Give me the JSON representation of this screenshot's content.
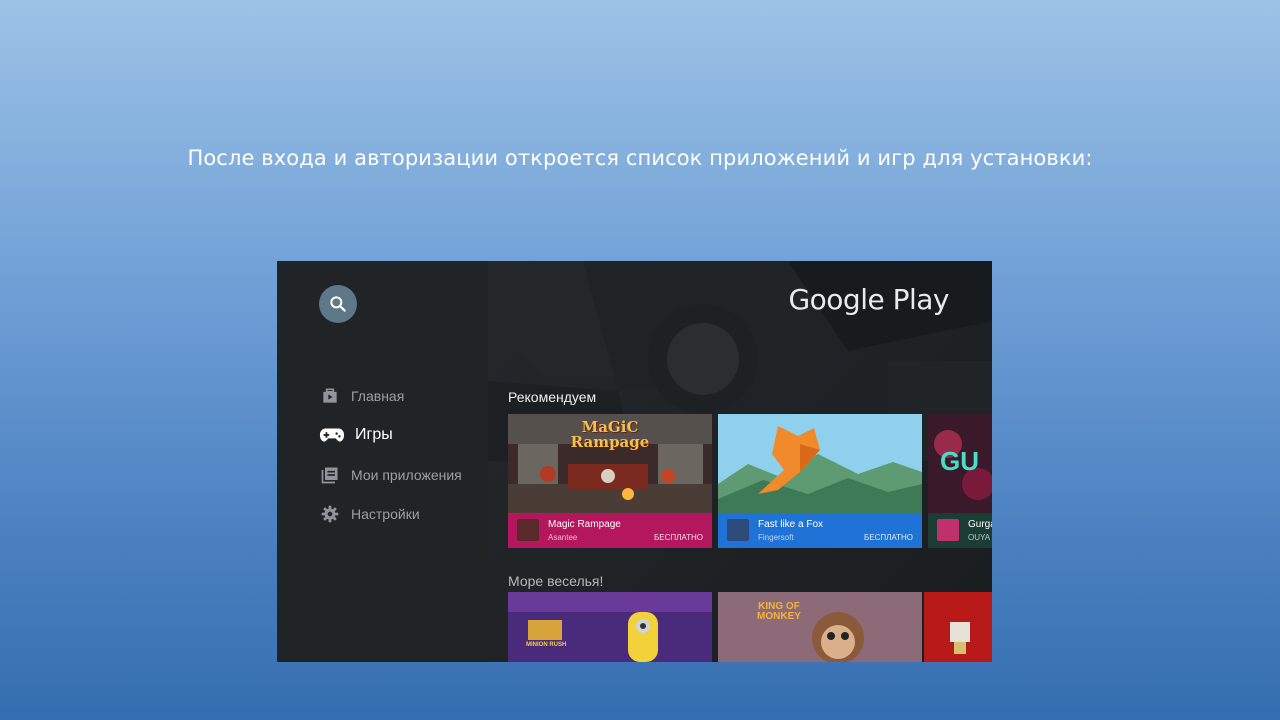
{
  "slide": {
    "caption": "После входа и авторизации откроется список приложений и игр для установки:"
  },
  "sidebar": {
    "search_icon": "search-icon",
    "items": [
      {
        "label": "Главная",
        "icon": "play-store-home-icon",
        "active": false
      },
      {
        "label": "Игры",
        "icon": "gamepad-icon",
        "active": true
      },
      {
        "label": "Мои приложения",
        "icon": "my-apps-icon",
        "active": false
      },
      {
        "label": "Настройки",
        "icon": "gear-icon",
        "active": false
      }
    ]
  },
  "header": {
    "logo_text": "Google Play"
  },
  "rows": [
    {
      "title": "Рекомендуем",
      "cards": [
        {
          "name": "Magic Rampage",
          "developer": "Asantee",
          "price": "БЕСПЛАТНО",
          "art_text": "MaGiC Rampage",
          "color": "#b5175e"
        },
        {
          "name": "Fast like a Fox",
          "developer": "Fingersoft",
          "price": "БЕСПЛАТНО",
          "color": "#1f73d6"
        },
        {
          "name": "Gurga",
          "developer": "OUYA G",
          "art_text": "GU",
          "color": "#1b3d36"
        }
      ]
    },
    {
      "title": "Море веселья!",
      "tiles": [
        {
          "art_text": "MINION RUSH"
        },
        {
          "art_text": "KING OF MONKEY"
        },
        {
          "art_text": ""
        }
      ]
    }
  ],
  "colors": {
    "sidebar_bg": "#202427",
    "search_bg": "#5e7887",
    "content_bg": "#1a1d20"
  }
}
